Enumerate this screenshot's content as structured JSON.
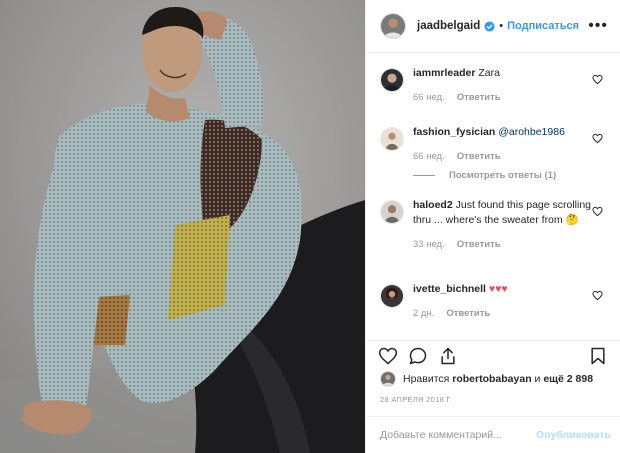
{
  "post": {
    "author": {
      "username": "jaadbelgaid",
      "verified_icon": "verified-badge-icon",
      "follow_label": "Подписаться",
      "separator": "•",
      "more_label": "•••"
    },
    "comments": [
      {
        "username": "iammrleader",
        "text": "Zara",
        "age": "66 нед.",
        "reply_label": "Ответить"
      },
      {
        "username": "fashion_fysician",
        "mention": "@arohbe1986",
        "age": "66 нед.",
        "reply_label": "Ответить",
        "view_replies": "Посмотреть ответы (1)"
      },
      {
        "username": "haloed2",
        "text": "Just found this page scrolling thru ... where's the sweater from 🤔",
        "age": "33 нед.",
        "reply_label": "Ответить"
      },
      {
        "username": "ivette_bichnell",
        "text": "♥♥♥",
        "age": "2 дн.",
        "reply_label": "Ответить"
      }
    ],
    "likes": {
      "prefix": "Нравится",
      "liker": "robertobabayan",
      "conj": "и",
      "others": "ещё 2 898"
    },
    "date": "28 АПРЕЛЯ 2018 Г.",
    "composer": {
      "placeholder": "Добавьте комментарий...",
      "publish_label": "Опубликовать"
    }
  },
  "colors": {
    "accent": "#3897f0",
    "heart": "#ed4956",
    "muted": "#999999",
    "publish_disabled": "#b2dffc"
  }
}
